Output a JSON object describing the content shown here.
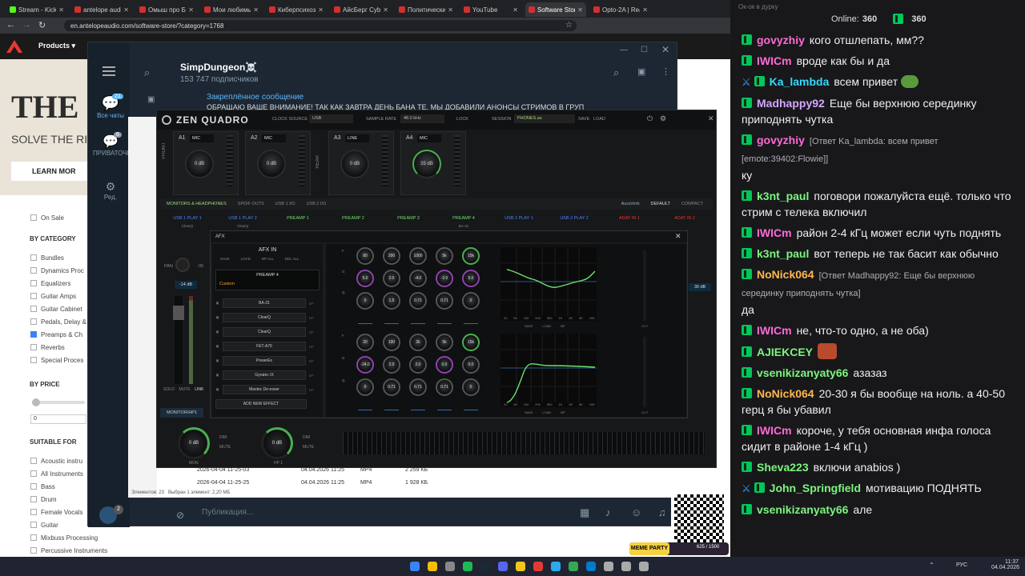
{
  "browser": {
    "tabs": [
      {
        "label": "Stream - Kick D",
        "color": "#53fc18",
        "active": false
      },
      {
        "label": "antelope audio",
        "color": "#d32f2f",
        "active": false
      },
      {
        "label": "Омыш про Бу",
        "color": "#d32f2f",
        "active": false
      },
      {
        "label": "Мои любимые",
        "color": "#d32f2f",
        "active": false
      },
      {
        "label": "Киберпсихоз",
        "color": "#d32f2f",
        "active": false
      },
      {
        "label": "АйсБерг Cyber",
        "color": "#d32f2f",
        "active": false
      },
      {
        "label": "Политический",
        "color": "#d32f2f",
        "active": false
      },
      {
        "label": "YouTube",
        "color": "#d32f2f",
        "active": false
      },
      {
        "label": "Software Store",
        "color": "#d32f2f",
        "active": true
      },
      {
        "label": "Opto-2A | Real",
        "color": "#d32f2f",
        "active": false
      }
    ],
    "url": "en.antelopeaudio.com/software-store/?category=1768",
    "site_nav": {
      "products": "Products"
    },
    "hero": {
      "title": "THE",
      "subtitle": "SOLVE THE RID",
      "cta": "LEARN MOR"
    },
    "filters": {
      "on_sale": "On Sale",
      "by_category": "BY CATEGORY",
      "categories": [
        {
          "label": "Bundles",
          "checked": false
        },
        {
          "label": "Dynamics Proc",
          "checked": false
        },
        {
          "label": "Equalizers",
          "checked": false
        },
        {
          "label": "Guitar Amps",
          "checked": false
        },
        {
          "label": "Guitar Cabinet",
          "checked": false
        },
        {
          "label": "Pedals, Delay &",
          "checked": false
        },
        {
          "label": "Preamps & Ch",
          "checked": true
        },
        {
          "label": "Reverbs",
          "checked": false
        },
        {
          "label": "Special Proces",
          "checked": false
        }
      ],
      "by_price": "BY PRICE",
      "price_min": "0",
      "suitable_for": "SUITABLE FOR",
      "suitable": [
        "Acoustic instru",
        "All Instruments",
        "Bass",
        "Drum",
        "Female Vocals",
        "Guitar",
        "Mixbuss Processing",
        "Percussive Instruments"
      ]
    }
  },
  "telegram": {
    "channel": "SimpDungeon☠️",
    "subscribers": "153 747 подписчиков",
    "pinned_title": "Закреплённое сообщение",
    "pinned_text": "ОБРАЩАЮ ВАШЕ ВНИМАНИЕ! ТАК КАК ЗАВТРА ДЕНЬ БАНА ТЕ, МЫ ДОБАВИЛИ АНОНСЫ СТРИМОВ В ГРУП",
    "folders": [
      {
        "label": "Все чаты",
        "count": "21"
      },
      {
        "label": "ПРИВАТОЧКА",
        "count": "6"
      },
      {
        "label": "Ред.",
        "count": ""
      }
    ],
    "composer_placeholder": "Публикация...",
    "bottom_count": "2"
  },
  "explorer": {
    "status_left": "Элементов: 23",
    "status_sel": "Выбран 1 элемент: 2,20 МБ",
    "rows": [
      {
        "name": "2026-04-04 11-25-03",
        "date": "04.04.2026 11:25",
        "type": "MP4",
        "size": "2 259 КБ"
      },
      {
        "name": "2026-04-04 11-25-25",
        "date": "04.04.2026 11:25",
        "type": "MP4",
        "size": "1 928 КБ"
      }
    ]
  },
  "zen": {
    "brand": "ZEN QUADRO",
    "clock_source_label": "CLOCK SOURCE",
    "clock_source": "USB",
    "sample_rate_label": "SAMPLE RATE",
    "sample_rate": "48.0 kHz",
    "lock_label": "LOCK",
    "session_label": "SESSION",
    "session": "PHONES.as",
    "save": "SAVE",
    "load": "LOAD",
    "front": "FRONT",
    "rear": "REAR",
    "channels": [
      {
        "id": "A1",
        "type": "MIC",
        "gain": "0 dB"
      },
      {
        "id": "A2",
        "type": "MIC",
        "gain": "0 dB"
      },
      {
        "id": "A3",
        "type": "LINE",
        "gain": "0 dB"
      },
      {
        "id": "A4",
        "type": "MIC",
        "gain": "35 dB"
      }
    ],
    "tabs": [
      "MONITORS & HEADPHONES",
      "SPDIF OUTS",
      "USB 1 I/O",
      "USB 2 I/O"
    ],
    "auraverb": "AuraVerb",
    "default": "DEFAULT",
    "compact": "COMPACT",
    "strips": [
      "USB 1 PLAY 1",
      "USB 1 PLAY 2",
      "PREAMP 1",
      "PREAMP 2",
      "PREAMP 3",
      "PREAMP 4",
      "USB 2 PLAY 1",
      "USB 2 PLAY 2",
      "ADAT IN 1",
      "ADAT IN 2"
    ],
    "strip_sub": [
      "ClearQ",
      "ClearQ",
      "",
      "",
      "",
      "BA-31",
      "",
      "",
      "",
      ""
    ],
    "pan": "PAN",
    "pan_val": "-30",
    "level": "-14 dB",
    "right_level": "30 dB",
    "solo": "SOLO",
    "mute": "MUTE",
    "link": "LINK",
    "monitor_tab": "MONITOR/HP1",
    "mon": "MON",
    "hp1": "HP 1",
    "mon_gain": "0 dB",
    "hp_gain": "0 dB",
    "dim": "DIM",
    "mute2": "MUTE"
  },
  "afx": {
    "title": "AFX",
    "afx_in": "AFX IN",
    "menu": [
      "SAVE",
      "LOAD",
      "BP ALL",
      "DEL ALL"
    ],
    "preamp": "PREAMP 4",
    "preset": "Custom",
    "effects": [
      "BA-31",
      "ClearQ",
      "ClearQ",
      "FET-A76",
      "PowerEx",
      "Gyratec IX",
      "Maxtec De-esser"
    ],
    "add_effect": "ADD NEW EFFECT",
    "bp": "BP",
    "eq1": {
      "freq": [
        "80",
        "200",
        "1000",
        "5k",
        "15k"
      ],
      "gain": [
        "5.0",
        "2.0",
        "-4.0",
        "-2.0",
        "5.0"
      ],
      "q": [
        "0",
        "1.5",
        "0.71",
        "0.71",
        "0"
      ]
    },
    "eq2": {
      "freq": [
        "20",
        "100",
        "2k",
        "5k",
        "15k"
      ],
      "gain": [
        "-24.0",
        "2.0",
        "2.0",
        "0.0",
        "0.0"
      ],
      "q": [
        "0",
        "0.71",
        "0.71",
        "0.71",
        "0"
      ]
    },
    "row_f": "F",
    "row_g": "G",
    "row_q": "Q",
    "graph_x": [
      "20",
      "50",
      "100",
      "200",
      "500",
      "1K",
      "2K",
      "5K",
      "10K"
    ],
    "graph_save": "SAVE",
    "graph_load": "LOAD",
    "graph_bp": "BP",
    "out": "OUT"
  },
  "chat": {
    "online_label": "Online:",
    "online": "360",
    "count2": "360",
    "header_hint": "Ок-ок в дурку",
    "messages": [
      {
        "user": "govyzhiy",
        "color": "#ff6ad5",
        "text": "кого отшлепать, мм??",
        "reply": "",
        "blue": false
      },
      {
        "user": "IWICm",
        "color": "#ff6ad5",
        "text": "вроде как бы и да",
        "reply": "",
        "blue": false
      },
      {
        "user": "Ka_lambda",
        "color": "#33d9ff",
        "text": "всем привет",
        "reply": "",
        "blue": true
      },
      {
        "user": "Madhappy92",
        "color": "#d5a6ff",
        "text": "Еще бы верхнюю серединку приподнять чутка",
        "reply": "",
        "blue": false
      },
      {
        "user": "govyzhiy",
        "color": "#ff6ad5",
        "text": "ку",
        "reply": "[Ответ Ka_lambda: всем привет [emote:39402:Flowie]]",
        "blue": false
      },
      {
        "user": "k3nt_paul",
        "color": "#7cf57c",
        "text": "поговори пожалуйста ещё. только что стрим с телека включил",
        "reply": "",
        "blue": false
      },
      {
        "user": "IWICm",
        "color": "#ff6ad5",
        "text": "район 2-4 кГц может если чуть поднять",
        "reply": "",
        "blue": false
      },
      {
        "user": "k3nt_paul",
        "color": "#7cf57c",
        "text": "вот теперь не так басит как обычно",
        "reply": "",
        "blue": false
      },
      {
        "user": "NoNick064",
        "color": "#ffb84d",
        "text": "да",
        "reply": "[Ответ Madhappy92: Еще бы верхнюю серединку приподнять чутка]",
        "blue": false
      },
      {
        "user": "IWICm",
        "color": "#ff6ad5",
        "text": "не, что-то одно, а не оба)",
        "reply": "",
        "blue": false
      },
      {
        "user": "AJIEKCEY",
        "color": "#7cf57c",
        "text": "",
        "reply": "",
        "blue": false
      },
      {
        "user": "vsenikizanyaty66",
        "color": "#7cf57c",
        "text": "азазаз",
        "reply": "",
        "blue": false
      },
      {
        "user": "NoNick064",
        "color": "#ffb84d",
        "text": "20-30 я бы вообще на ноль. а 40-50 герц я бы убавил",
        "reply": "",
        "blue": false
      },
      {
        "user": "IWICm",
        "color": "#ff6ad5",
        "text": "короче, у тебя основная инфа голоса сидит в районе 1-4 кГц )",
        "reply": "",
        "blue": false
      },
      {
        "user": "Sheva223",
        "color": "#7cf57c",
        "text": "включи anabios )",
        "reply": "",
        "blue": false
      },
      {
        "user": "John_Springfield",
        "color": "#7cf57c",
        "text": "мотивацию ПОДНЯТЬ",
        "reply": "",
        "blue": true
      },
      {
        "user": "vsenikizanyaty66",
        "color": "#7cf57c",
        "text": "але",
        "reply": "",
        "blue": false
      }
    ],
    "meme_party": "MEME PARTY",
    "meme_progress": "625 / 1500"
  },
  "taskbar": {
    "lang": "РУС",
    "time": "11:37",
    "date": "04.04.2026"
  }
}
